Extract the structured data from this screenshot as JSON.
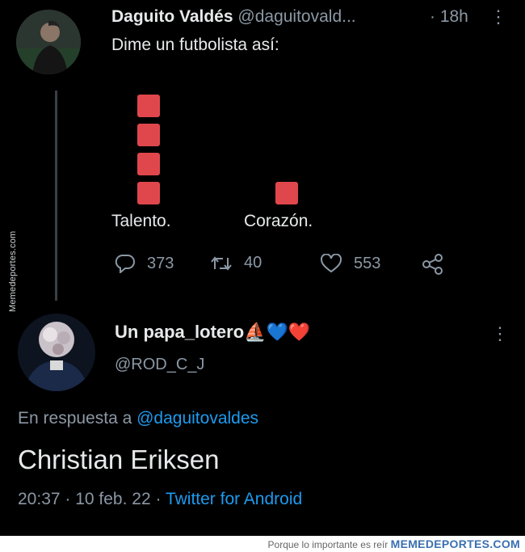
{
  "tweet": {
    "author_name": "Daguito Valdés",
    "author_handle": "@daguitovald...",
    "time": "· 18h",
    "more_icon": "⋮",
    "text": "Dime un futbolista así:",
    "label_left": "Talento.",
    "label_right": "Corazón.",
    "replies": "373",
    "retweets": "40",
    "likes": "553",
    "accent_color": "#e0474c"
  },
  "reply": {
    "author_name": "Un papa_lotero⛵💙❤️",
    "author_handle": "@ROD_C_J",
    "more_icon": "⋮",
    "reply_prefix": "En respuesta a",
    "reply_mention": "@daguitovaldes",
    "text": "Christian Eriksen",
    "timestamp": "20:37 · 10 feb. 22 ·",
    "source": "Twitter for Android"
  },
  "watermark": {
    "side": "Memedeportes.com",
    "footer_slogan": "Porque lo importante es reír",
    "footer_brand": "MEMEDEPORTES.COM"
  }
}
